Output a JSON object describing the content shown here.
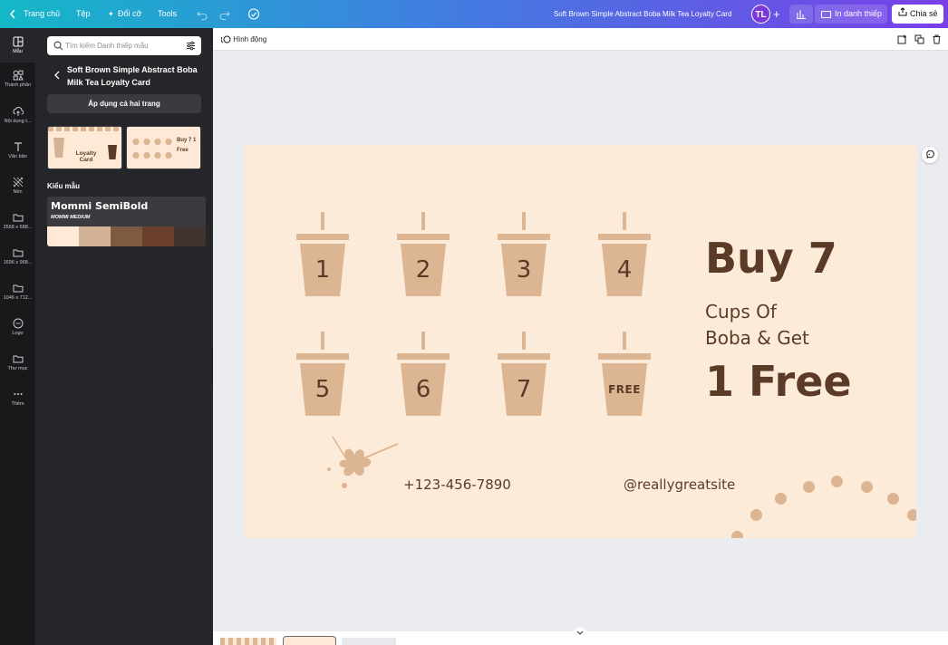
{
  "topbar": {
    "home": "Trang chủ",
    "file": "Tệp",
    "resize": "Đổi cỡ",
    "tools": "Tools",
    "doc_title": "Soft Brown Simple Abstract Boba Milk Tea Loyalty Card",
    "avatar_initials": "TL",
    "print_label": "In danh thiếp",
    "share_label": "Chia sẻ"
  },
  "rail": {
    "items": [
      {
        "label": "Mẫu",
        "icon": "template-icon"
      },
      {
        "label": "Thành phần",
        "icon": "elements-icon"
      },
      {
        "label": "Nội dung t...",
        "icon": "upload-icon"
      },
      {
        "label": "Văn bản",
        "icon": "text-icon"
      },
      {
        "label": "Nền",
        "icon": "background-icon"
      },
      {
        "label": "2568 x 688...",
        "icon": "folder-icon"
      },
      {
        "label": "1696 x 968...",
        "icon": "folder-icon"
      },
      {
        "label": "1046 x 712...",
        "icon": "folder-icon"
      },
      {
        "label": "Logo",
        "icon": "logo-icon"
      },
      {
        "label": "Thư mục",
        "icon": "folder-icon"
      },
      {
        "label": "Thêm",
        "icon": "more-icon"
      }
    ]
  },
  "panel": {
    "search_placeholder": "Tìm kiếm Danh thiếp mẫu",
    "template_title": "Soft Brown Simple Abstract Boba Milk Tea Loyalty Card",
    "apply_label": "Áp dụng cả hai trang",
    "thumb1_text": "Loyalty Card",
    "thumb2_text": "Buy 7 1 Free",
    "styles_heading": "Kiểu mẫu",
    "font_primary": "Mommi SemiBold",
    "font_secondary": "MOMMI MEDIUM",
    "palette": [
      "#fde9d6",
      "#d3b395",
      "#7f5a43",
      "#6b3f2b",
      "#3f3430"
    ]
  },
  "toolbar2": {
    "animate_label": "Hình động"
  },
  "card": {
    "cups": [
      "1",
      "2",
      "3",
      "4",
      "5",
      "6",
      "7",
      "FREE"
    ],
    "line1": "Buy 7",
    "line2": "Cups Of",
    "line3": "Boba & Get",
    "line4": "1 Free",
    "phone": "+123-456-7890",
    "website": "@reallygreatsite"
  },
  "colors": {
    "card_bg": "#fdebd9",
    "cup": "#dcb593",
    "text_brown": "#5b3a28"
  }
}
